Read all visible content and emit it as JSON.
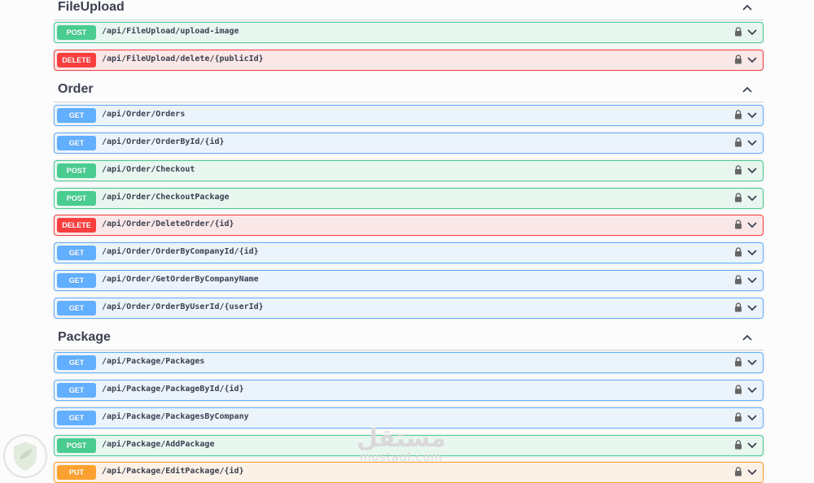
{
  "sections": [
    {
      "title": "FileUpload",
      "ops": [
        {
          "method": "POST",
          "path": "/api/FileUpload/upload-image"
        },
        {
          "method": "DELETE",
          "path": "/api/FileUpload/delete/{publicId}"
        }
      ]
    },
    {
      "title": "Order",
      "ops": [
        {
          "method": "GET",
          "path": "/api/Order/Orders"
        },
        {
          "method": "GET",
          "path": "/api/Order/OrderById/{id}"
        },
        {
          "method": "POST",
          "path": "/api/Order/Checkout"
        },
        {
          "method": "POST",
          "path": "/api/Order/CheckoutPackage"
        },
        {
          "method": "DELETE",
          "path": "/api/Order/DeleteOrder/{id}"
        },
        {
          "method": "GET",
          "path": "/api/Order/OrderByCompanyId/{id}"
        },
        {
          "method": "GET",
          "path": "/api/Order/GetOrderByCompanyName"
        },
        {
          "method": "GET",
          "path": "/api/Order/OrderByUserId/{userId}"
        }
      ]
    },
    {
      "title": "Package",
      "ops": [
        {
          "method": "GET",
          "path": "/api/Package/Packages"
        },
        {
          "method": "GET",
          "path": "/api/Package/PackageById/{id}"
        },
        {
          "method": "GET",
          "path": "/api/Package/PackagesByCompany"
        },
        {
          "method": "POST",
          "path": "/api/Package/AddPackage"
        },
        {
          "method": "PUT",
          "path": "/api/Package/EditPackage/{id}"
        }
      ]
    }
  ],
  "icons": {
    "lock": "lock-icon",
    "expand": "chevron-down-icon",
    "collapse": "chevron-up-icon"
  },
  "colors": {
    "get": "#61affe",
    "post": "#49cc90",
    "delete": "#f93e3e",
    "put": "#fca130"
  },
  "watermark": {
    "arabic": "مستقل",
    "latin": "mostaql.com"
  }
}
